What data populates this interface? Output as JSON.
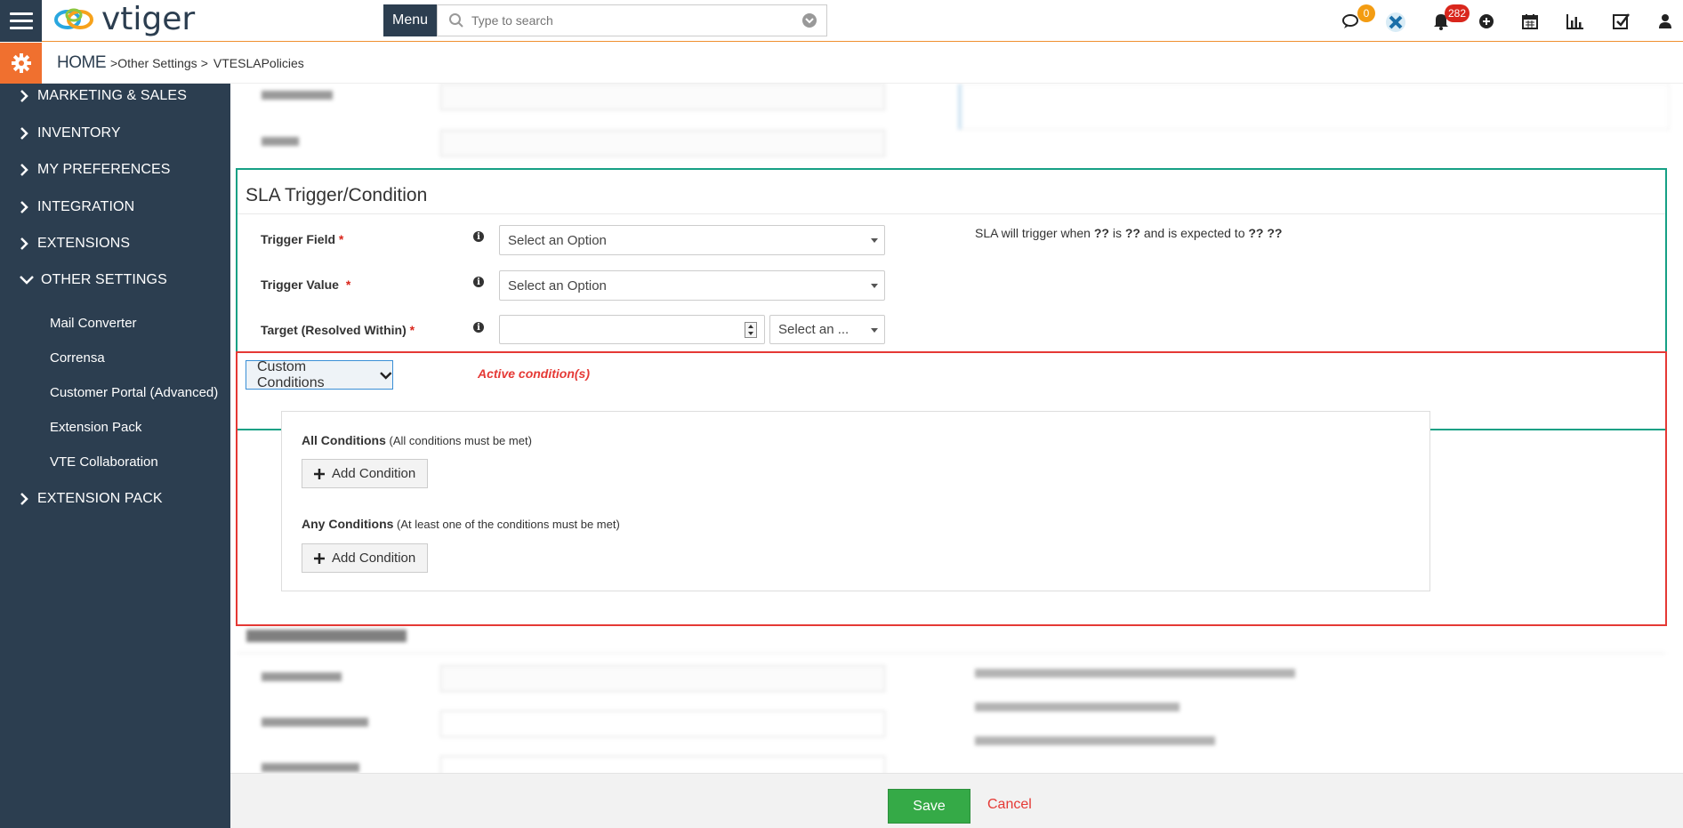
{
  "header": {
    "logo_text": "vtiger",
    "menu_label": "Menu",
    "search_placeholder": "Type to search",
    "chat_badge": "0",
    "notification_badge": "282"
  },
  "breadcrumb": {
    "home": "HOME",
    "sep1": ">",
    "level1": "Other Settings",
    "sep2": ">",
    "level2": "VTESLAPolicies"
  },
  "sidebar": {
    "items": [
      {
        "label": "MARKETING & SALES"
      },
      {
        "label": "INVENTORY"
      },
      {
        "label": "MY PREFERENCES"
      },
      {
        "label": "INTEGRATION"
      },
      {
        "label": "EXTENSIONS"
      },
      {
        "label": "OTHER SETTINGS"
      },
      {
        "label": "EXTENSION PACK"
      }
    ],
    "sub_items": [
      {
        "label": "Mail Converter"
      },
      {
        "label": "Corrensa"
      },
      {
        "label": "Customer Portal (Advanced)"
      },
      {
        "label": "Extension Pack"
      },
      {
        "label": "VTE Collaboration"
      }
    ]
  },
  "sla_trigger": {
    "title": "SLA Trigger/Condition",
    "trigger_field_label": "Trigger Field",
    "trigger_field_value": "Select an Option",
    "trigger_value_label": "Trigger Value",
    "trigger_value_value": "Select an Option",
    "target_label": "Target (Resolved Within)",
    "target_value": "",
    "target_unit": "Select an ...",
    "summary_prefix": "SLA will trigger when ",
    "summary_q1": "??",
    "summary_mid1": " is ",
    "summary_q2": "??",
    "summary_mid2": " and is expected to ",
    "summary_q3": "?? ??",
    "required_mark": "*"
  },
  "custom_conditions": {
    "button_label": "Custom Conditions",
    "active_label": "Active condition(s)",
    "all_title": "All Conditions",
    "all_note": " (All conditions must be met)",
    "any_title": "Any Conditions",
    "any_note": " (At least one of the conditions must be met)",
    "add_label": "Add Condition"
  },
  "footer": {
    "save_label": "Save",
    "cancel_label": "Cancel"
  },
  "colors": {
    "sidebar_bg": "#2c3e50",
    "accent_orange": "#f0702f",
    "green_border": "#16a085",
    "red_border": "#e53935",
    "save_green": "#35aa47"
  }
}
